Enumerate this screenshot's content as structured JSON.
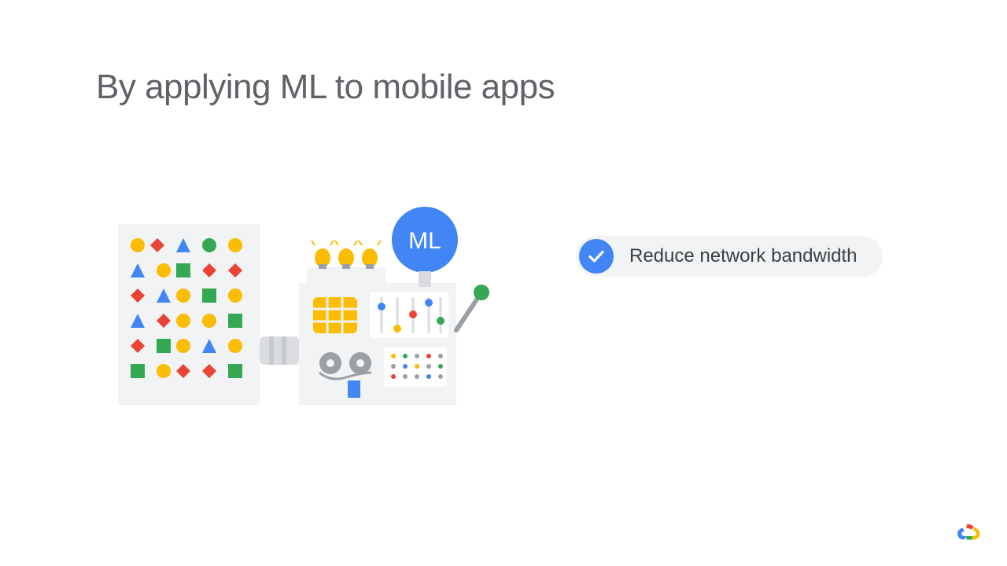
{
  "title": "By applying ML to mobile apps",
  "ml_badge_label": "ML",
  "bullets": [
    {
      "label": "Reduce network bandwidth"
    }
  ],
  "colors": {
    "blue": "#4285f4",
    "red": "#ea4335",
    "yellow": "#fbbc04",
    "green": "#34a853",
    "grey_bg": "#f1f3f4",
    "grey_md": "#dadce0",
    "grey_dk": "#9aa0a6",
    "text": "#5f6368"
  }
}
